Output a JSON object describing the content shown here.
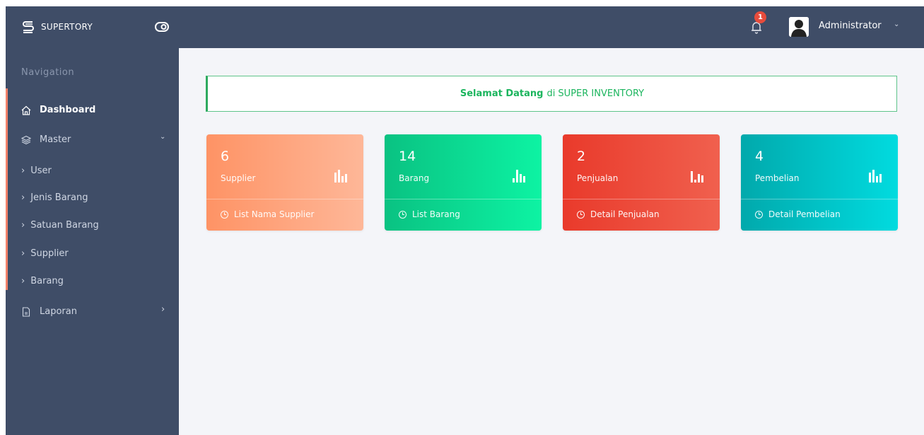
{
  "brand": {
    "name": "SUPERTORY",
    "icon": "brand-s-icon"
  },
  "header": {
    "notification_count": "1",
    "user_name": "Administrator",
    "user_chevron": "⌄"
  },
  "sidebar": {
    "caption": "Navigation",
    "items": [
      {
        "label": "Dashboard",
        "icon": "home-icon"
      },
      {
        "label": "Master",
        "icon": "layers-icon",
        "chevron": "⌄"
      },
      {
        "label": "Laporan",
        "icon": "file-icon",
        "chevron": "›"
      }
    ],
    "submenu": [
      {
        "label": "User"
      },
      {
        "label": "Jenis Barang"
      },
      {
        "label": "Satuan Barang"
      },
      {
        "label": "Supplier"
      },
      {
        "label": "Barang"
      }
    ]
  },
  "welcome": {
    "bold": "Selamat Datang",
    "rest": "di SUPER INVENTORY"
  },
  "cards": [
    {
      "value": "6",
      "label": "Supplier",
      "footer": "List Nama Supplier",
      "color_from": "#fe9365",
      "color_to": "#feb798"
    },
    {
      "value": "14",
      "label": "Barang",
      "footer": "List Barang",
      "color_from": "#0ac282",
      "color_to": "#0df3a3"
    },
    {
      "value": "2",
      "label": "Penjualan",
      "footer": "Detail Penjualan",
      "color_from": "#e93a2b",
      "color_to": "#f0604e"
    },
    {
      "value": "4",
      "label": "Pembelian",
      "footer": "Detail Pembelian",
      "color_from": "#01a9ac",
      "color_to": "#01dbdf"
    }
  ],
  "colors": {
    "header_bg": "#3f4d67",
    "sidebar_bg": "#3f4d67",
    "content_bg": "#f4f5f9",
    "welcome_text": "#1cb55e",
    "active_bar": "#f0816a"
  }
}
